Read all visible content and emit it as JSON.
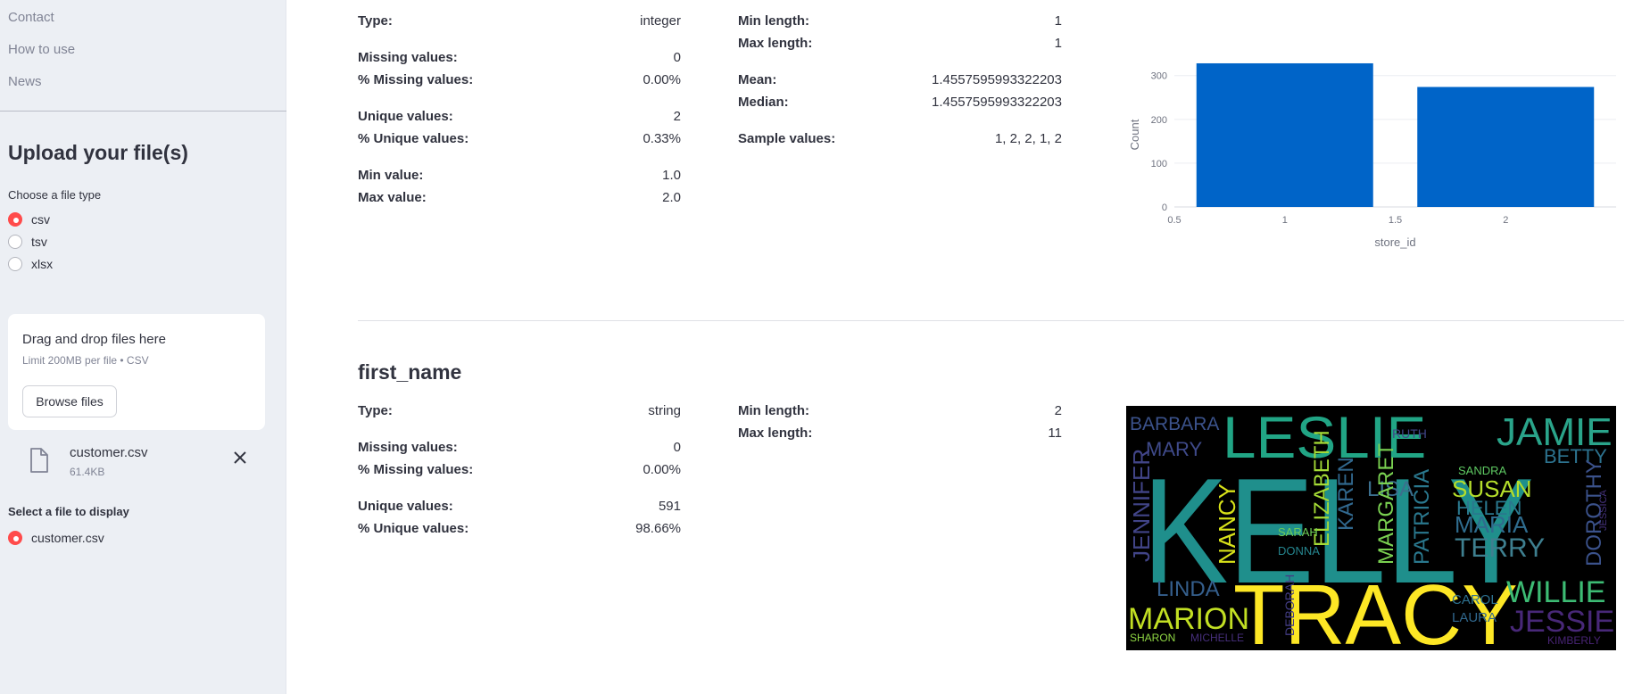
{
  "sidebar": {
    "nav": [
      "Contact",
      "How to use",
      "News"
    ],
    "upload_title": "Upload your file(s)",
    "file_type_label": "Choose a file type",
    "file_types": [
      {
        "label": "csv",
        "checked": true
      },
      {
        "label": "tsv",
        "checked": false
      },
      {
        "label": "xlsx",
        "checked": false
      }
    ],
    "dropzone": {
      "title": "Drag and drop files here",
      "limit": "Limit 200MB per file • CSV",
      "browse_label": "Browse files"
    },
    "uploaded_file": {
      "name": "customer.csv",
      "size": "61.4KB",
      "icon": "file-icon"
    },
    "select_label": "Select a file to display",
    "display_options": [
      {
        "label": "customer.csv",
        "checked": true
      }
    ]
  },
  "store_id": {
    "left": [
      {
        "label": "Type:",
        "value": "integer"
      },
      {
        "label": "Missing values:",
        "value": "0"
      },
      {
        "label": "% Missing values:",
        "value": "0.00%"
      },
      {
        "label": "Unique values:",
        "value": "2"
      },
      {
        "label": "% Unique values:",
        "value": "0.33%"
      },
      {
        "label": "Min value:",
        "value": "1.0"
      },
      {
        "label": "Max value:",
        "value": "2.0"
      }
    ],
    "right": [
      {
        "label": "Min length:",
        "value": "1"
      },
      {
        "label": "Max length:",
        "value": "1"
      },
      {
        "label": "Mean:",
        "value": "1.4557595993322203"
      },
      {
        "label": "Median:",
        "value": "1.4557595993322203"
      },
      {
        "label": "Sample values:",
        "value": "1, 2, 2, 1, 2"
      }
    ]
  },
  "first_name": {
    "title": "first_name",
    "left": [
      {
        "label": "Type:",
        "value": "string"
      },
      {
        "label": "Missing values:",
        "value": "0"
      },
      {
        "label": "% Missing values:",
        "value": "0.00%"
      },
      {
        "label": "Unique values:",
        "value": "591"
      },
      {
        "label": "% Unique values:",
        "value": "98.66%"
      }
    ],
    "right": [
      {
        "label": "Min length:",
        "value": "2"
      },
      {
        "label": "Max length:",
        "value": "11"
      }
    ],
    "wordcloud": [
      {
        "text": "KELLY",
        "color": "#1f8f8c"
      },
      {
        "text": "TRACY",
        "color": "#fde725"
      },
      {
        "text": "LESLIE",
        "color": "#21a585"
      },
      {
        "text": "JAMIE",
        "color": "#2aa48a"
      },
      {
        "text": "BARBARA",
        "color": "#3b528b"
      },
      {
        "text": "MARY",
        "color": "#3f4a8a"
      },
      {
        "text": "BETTY",
        "color": "#2c728e"
      },
      {
        "text": "LISA",
        "color": "#3b6f8e"
      },
      {
        "text": "KAREN",
        "color": "#31688e"
      },
      {
        "text": "SUSAN",
        "color": "#b5de2b"
      },
      {
        "text": "HELEN",
        "color": "#2a788e"
      },
      {
        "text": "MARIA",
        "color": "#2f6c8e"
      },
      {
        "text": "TERRY",
        "color": "#3e7f8f"
      },
      {
        "text": "DOROTHY",
        "color": "#3b528b"
      },
      {
        "text": "JENNIFER",
        "color": "#414487"
      },
      {
        "text": "NANCY",
        "color": "#d8e219"
      },
      {
        "text": "ELIZABETH",
        "color": "#a5db36"
      },
      {
        "text": "MARGARET",
        "color": "#7ad151"
      },
      {
        "text": "PATRICIA",
        "color": "#2a788e"
      },
      {
        "text": "LINDA",
        "color": "#355f8d"
      },
      {
        "text": "MARION",
        "color": "#c2df23"
      },
      {
        "text": "WILLIE",
        "color": "#3dbc74"
      },
      {
        "text": "JESSIE",
        "color": "#482878"
      },
      {
        "text": "CAROL",
        "color": "#2d708e"
      },
      {
        "text": "LAURA",
        "color": "#31688e"
      },
      {
        "text": "SARAH",
        "color": "#6ece58"
      },
      {
        "text": "DONNA",
        "color": "#25858e"
      },
      {
        "text": "SANDRA",
        "color": "#5ec962"
      },
      {
        "text": "RUTH",
        "color": "#404688"
      },
      {
        "text": "DEBORAH",
        "color": "#433d84"
      },
      {
        "text": "SHARON",
        "color": "#8fd744"
      },
      {
        "text": "MICHELLE",
        "color": "#472f7d"
      },
      {
        "text": "KIMBERLY",
        "color": "#482475"
      },
      {
        "text": "JESSICA",
        "color": "#46327e"
      }
    ]
  },
  "chart_data": {
    "type": "bar",
    "x": [
      1,
      2
    ],
    "values": [
      328,
      274
    ],
    "xlabel": "store_id",
    "ylabel": "Count",
    "xticks": [
      "0.5",
      "1",
      "1.5",
      "2"
    ],
    "yticks": [
      "0",
      "100",
      "200",
      "300"
    ],
    "xlim": [
      0.5,
      2.5
    ],
    "ylim": [
      0,
      330
    ],
    "grid": true,
    "bar_color": "#0064c8"
  }
}
